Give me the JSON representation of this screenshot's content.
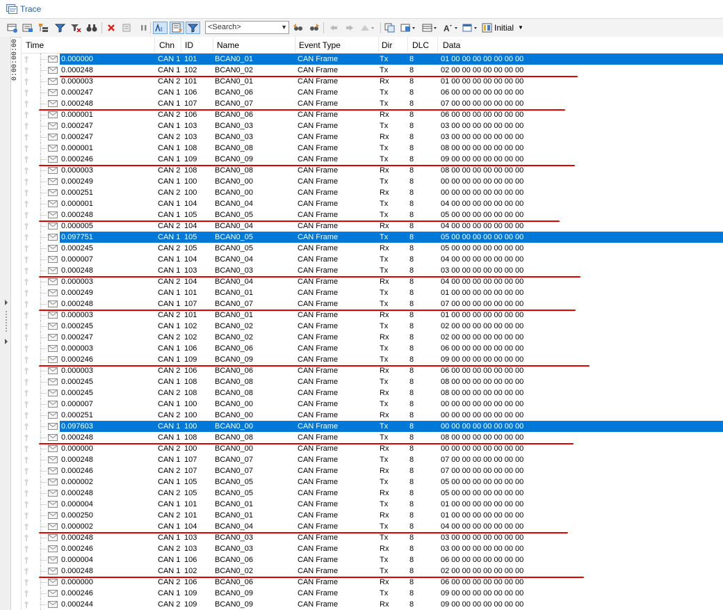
{
  "window": {
    "title": "Trace",
    "title_icon": "trace-window-icon"
  },
  "toolbar": {
    "search_placeholder": "<Search>",
    "display_mode_label": "Initial"
  },
  "timeline": {
    "label": "0:00:00:00"
  },
  "columns": [
    "Time",
    "Chn",
    "ID",
    "Name",
    "Event Type",
    "Dir",
    "DLC",
    "Data"
  ],
  "colors": {
    "selection": "#0078d7",
    "annotation_line": "#e10000",
    "title_text": "#1a5fa8"
  },
  "rows": [
    {
      "time": "0.000000",
      "chn": "CAN 1",
      "id": "101",
      "name": "BCAN0_01",
      "event": "CAN Frame",
      "dir": "Tx",
      "dlc": "8",
      "data": "01 00 00 00 00 00 00 00",
      "selected": true
    },
    {
      "time": "0.000248",
      "chn": "CAN 1",
      "id": "102",
      "name": "BCAN0_02",
      "event": "CAN Frame",
      "dir": "Tx",
      "dlc": "8",
      "data": "02 00 00 00 00 00 00 00"
    },
    {
      "time": "0.000003",
      "chn": "CAN 2",
      "id": "101",
      "name": "BCAN0_01",
      "event": "CAN Frame",
      "dir": "Rx",
      "dlc": "8",
      "data": "01 00 00 00 00 00 00 00"
    },
    {
      "time": "0.000247",
      "chn": "CAN 1",
      "id": "106",
      "name": "BCAN0_06",
      "event": "CAN Frame",
      "dir": "Tx",
      "dlc": "8",
      "data": "06 00 00 00 00 00 00 00"
    },
    {
      "time": "0.000248",
      "chn": "CAN 1",
      "id": "107",
      "name": "BCAN0_07",
      "event": "CAN Frame",
      "dir": "Tx",
      "dlc": "8",
      "data": "07 00 00 00 00 00 00 00"
    },
    {
      "time": "0.000001",
      "chn": "CAN 2",
      "id": "106",
      "name": "BCAN0_06",
      "event": "CAN Frame",
      "dir": "Rx",
      "dlc": "8",
      "data": "06 00 00 00 00 00 00 00"
    },
    {
      "time": "0.000247",
      "chn": "CAN 1",
      "id": "103",
      "name": "BCAN0_03",
      "event": "CAN Frame",
      "dir": "Tx",
      "dlc": "8",
      "data": "03 00 00 00 00 00 00 00"
    },
    {
      "time": "0.000247",
      "chn": "CAN 2",
      "id": "103",
      "name": "BCAN0_03",
      "event": "CAN Frame",
      "dir": "Rx",
      "dlc": "8",
      "data": "03 00 00 00 00 00 00 00"
    },
    {
      "time": "0.000001",
      "chn": "CAN 1",
      "id": "108",
      "name": "BCAN0_08",
      "event": "CAN Frame",
      "dir": "Tx",
      "dlc": "8",
      "data": "08 00 00 00 00 00 00 00"
    },
    {
      "time": "0.000246",
      "chn": "CAN 1",
      "id": "109",
      "name": "BCAN0_09",
      "event": "CAN Frame",
      "dir": "Tx",
      "dlc": "8",
      "data": "09 00 00 00 00 00 00 00"
    },
    {
      "time": "0.000003",
      "chn": "CAN 2",
      "id": "108",
      "name": "BCAN0_08",
      "event": "CAN Frame",
      "dir": "Rx",
      "dlc": "8",
      "data": "08 00 00 00 00 00 00 00"
    },
    {
      "time": "0.000249",
      "chn": "CAN 1",
      "id": "100",
      "name": "BCAN0_00",
      "event": "CAN Frame",
      "dir": "Tx",
      "dlc": "8",
      "data": "00 00 00 00 00 00 00 00"
    },
    {
      "time": "0.000251",
      "chn": "CAN 2",
      "id": "100",
      "name": "BCAN0_00",
      "event": "CAN Frame",
      "dir": "Rx",
      "dlc": "8",
      "data": "00 00 00 00 00 00 00 00"
    },
    {
      "time": "0.000001",
      "chn": "CAN 1",
      "id": "104",
      "name": "BCAN0_04",
      "event": "CAN Frame",
      "dir": "Tx",
      "dlc": "8",
      "data": "04 00 00 00 00 00 00 00"
    },
    {
      "time": "0.000248",
      "chn": "CAN 1",
      "id": "105",
      "name": "BCAN0_05",
      "event": "CAN Frame",
      "dir": "Tx",
      "dlc": "8",
      "data": "05 00 00 00 00 00 00 00"
    },
    {
      "time": "0.000005",
      "chn": "CAN 2",
      "id": "104",
      "name": "BCAN0_04",
      "event": "CAN Frame",
      "dir": "Rx",
      "dlc": "8",
      "data": "04 00 00 00 00 00 00 00"
    },
    {
      "time": "0.097751",
      "chn": "CAN 1",
      "id": "105",
      "name": "BCAN0_05",
      "event": "CAN Frame",
      "dir": "Tx",
      "dlc": "8",
      "data": "05 00 00 00 00 00 00 00",
      "selected": true
    },
    {
      "time": "0.000245",
      "chn": "CAN 2",
      "id": "105",
      "name": "BCAN0_05",
      "event": "CAN Frame",
      "dir": "Rx",
      "dlc": "8",
      "data": "05 00 00 00 00 00 00 00"
    },
    {
      "time": "0.000007",
      "chn": "CAN 1",
      "id": "104",
      "name": "BCAN0_04",
      "event": "CAN Frame",
      "dir": "Tx",
      "dlc": "8",
      "data": "04 00 00 00 00 00 00 00"
    },
    {
      "time": "0.000248",
      "chn": "CAN 1",
      "id": "103",
      "name": "BCAN0_03",
      "event": "CAN Frame",
      "dir": "Tx",
      "dlc": "8",
      "data": "03 00 00 00 00 00 00 00"
    },
    {
      "time": "0.000003",
      "chn": "CAN 2",
      "id": "104",
      "name": "BCAN0_04",
      "event": "CAN Frame",
      "dir": "Rx",
      "dlc": "8",
      "data": "04 00 00 00 00 00 00 00"
    },
    {
      "time": "0.000249",
      "chn": "CAN 1",
      "id": "101",
      "name": "BCAN0_01",
      "event": "CAN Frame",
      "dir": "Tx",
      "dlc": "8",
      "data": "01 00 00 00 00 00 00 00"
    },
    {
      "time": "0.000248",
      "chn": "CAN 1",
      "id": "107",
      "name": "BCAN0_07",
      "event": "CAN Frame",
      "dir": "Tx",
      "dlc": "8",
      "data": "07 00 00 00 00 00 00 00"
    },
    {
      "time": "0.000003",
      "chn": "CAN 2",
      "id": "101",
      "name": "BCAN0_01",
      "event": "CAN Frame",
      "dir": "Rx",
      "dlc": "8",
      "data": "01 00 00 00 00 00 00 00"
    },
    {
      "time": "0.000245",
      "chn": "CAN 1",
      "id": "102",
      "name": "BCAN0_02",
      "event": "CAN Frame",
      "dir": "Tx",
      "dlc": "8",
      "data": "02 00 00 00 00 00 00 00"
    },
    {
      "time": "0.000247",
      "chn": "CAN 2",
      "id": "102",
      "name": "BCAN0_02",
      "event": "CAN Frame",
      "dir": "Rx",
      "dlc": "8",
      "data": "02 00 00 00 00 00 00 00"
    },
    {
      "time": "0.000003",
      "chn": "CAN 1",
      "id": "106",
      "name": "BCAN0_06",
      "event": "CAN Frame",
      "dir": "Tx",
      "dlc": "8",
      "data": "06 00 00 00 00 00 00 00"
    },
    {
      "time": "0.000246",
      "chn": "CAN 1",
      "id": "109",
      "name": "BCAN0_09",
      "event": "CAN Frame",
      "dir": "Tx",
      "dlc": "8",
      "data": "09 00 00 00 00 00 00 00"
    },
    {
      "time": "0.000003",
      "chn": "CAN 2",
      "id": "106",
      "name": "BCAN0_06",
      "event": "CAN Frame",
      "dir": "Rx",
      "dlc": "8",
      "data": "06 00 00 00 00 00 00 00"
    },
    {
      "time": "0.000245",
      "chn": "CAN 1",
      "id": "108",
      "name": "BCAN0_08",
      "event": "CAN Frame",
      "dir": "Tx",
      "dlc": "8",
      "data": "08 00 00 00 00 00 00 00"
    },
    {
      "time": "0.000245",
      "chn": "CAN 2",
      "id": "108",
      "name": "BCAN0_08",
      "event": "CAN Frame",
      "dir": "Rx",
      "dlc": "8",
      "data": "08 00 00 00 00 00 00 00"
    },
    {
      "time": "0.000007",
      "chn": "CAN 1",
      "id": "100",
      "name": "BCAN0_00",
      "event": "CAN Frame",
      "dir": "Tx",
      "dlc": "8",
      "data": "00 00 00 00 00 00 00 00"
    },
    {
      "time": "0.000251",
      "chn": "CAN 2",
      "id": "100",
      "name": "BCAN0_00",
      "event": "CAN Frame",
      "dir": "Rx",
      "dlc": "8",
      "data": "00 00 00 00 00 00 00 00"
    },
    {
      "time": "0.097603",
      "chn": "CAN 1",
      "id": "100",
      "name": "BCAN0_00",
      "event": "CAN Frame",
      "dir": "Tx",
      "dlc": "8",
      "data": "00 00 00 00 00 00 00 00",
      "selected": true
    },
    {
      "time": "0.000248",
      "chn": "CAN 1",
      "id": "108",
      "name": "BCAN0_08",
      "event": "CAN Frame",
      "dir": "Tx",
      "dlc": "8",
      "data": "08 00 00 00 00 00 00 00"
    },
    {
      "time": "0.000000",
      "chn": "CAN 2",
      "id": "100",
      "name": "BCAN0_00",
      "event": "CAN Frame",
      "dir": "Rx",
      "dlc": "8",
      "data": "00 00 00 00 00 00 00 00"
    },
    {
      "time": "0.000248",
      "chn": "CAN 1",
      "id": "107",
      "name": "BCAN0_07",
      "event": "CAN Frame",
      "dir": "Tx",
      "dlc": "8",
      "data": "07 00 00 00 00 00 00 00"
    },
    {
      "time": "0.000246",
      "chn": "CAN 2",
      "id": "107",
      "name": "BCAN0_07",
      "event": "CAN Frame",
      "dir": "Rx",
      "dlc": "8",
      "data": "07 00 00 00 00 00 00 00"
    },
    {
      "time": "0.000002",
      "chn": "CAN 1",
      "id": "105",
      "name": "BCAN0_05",
      "event": "CAN Frame",
      "dir": "Tx",
      "dlc": "8",
      "data": "05 00 00 00 00 00 00 00"
    },
    {
      "time": "0.000248",
      "chn": "CAN 2",
      "id": "105",
      "name": "BCAN0_05",
      "event": "CAN Frame",
      "dir": "Rx",
      "dlc": "8",
      "data": "05 00 00 00 00 00 00 00"
    },
    {
      "time": "0.000004",
      "chn": "CAN 1",
      "id": "101",
      "name": "BCAN0_01",
      "event": "CAN Frame",
      "dir": "Tx",
      "dlc": "8",
      "data": "01 00 00 00 00 00 00 00"
    },
    {
      "time": "0.000250",
      "chn": "CAN 2",
      "id": "101",
      "name": "BCAN0_01",
      "event": "CAN Frame",
      "dir": "Rx",
      "dlc": "8",
      "data": "01 00 00 00 00 00 00 00"
    },
    {
      "time": "0.000002",
      "chn": "CAN 1",
      "id": "104",
      "name": "BCAN0_04",
      "event": "CAN Frame",
      "dir": "Tx",
      "dlc": "8",
      "data": "04 00 00 00 00 00 00 00"
    },
    {
      "time": "0.000248",
      "chn": "CAN 1",
      "id": "103",
      "name": "BCAN0_03",
      "event": "CAN Frame",
      "dir": "Tx",
      "dlc": "8",
      "data": "03 00 00 00 00 00 00 00"
    },
    {
      "time": "0.000246",
      "chn": "CAN 2",
      "id": "103",
      "name": "BCAN0_03",
      "event": "CAN Frame",
      "dir": "Rx",
      "dlc": "8",
      "data": "03 00 00 00 00 00 00 00"
    },
    {
      "time": "0.000004",
      "chn": "CAN 1",
      "id": "106",
      "name": "BCAN0_06",
      "event": "CAN Frame",
      "dir": "Tx",
      "dlc": "8",
      "data": "06 00 00 00 00 00 00 00"
    },
    {
      "time": "0.000248",
      "chn": "CAN 1",
      "id": "102",
      "name": "BCAN0_02",
      "event": "CAN Frame",
      "dir": "Tx",
      "dlc": "8",
      "data": "02 00 00 00 00 00 00 00"
    },
    {
      "time": "0.000000",
      "chn": "CAN 2",
      "id": "106",
      "name": "BCAN0_06",
      "event": "CAN Frame",
      "dir": "Rx",
      "dlc": "8",
      "data": "06 00 00 00 00 00 00 00"
    },
    {
      "time": "0.000246",
      "chn": "CAN 1",
      "id": "109",
      "name": "BCAN0_09",
      "event": "CAN Frame",
      "dir": "Tx",
      "dlc": "8",
      "data": "09 00 00 00 00 00 00 00"
    },
    {
      "time": "0.000244",
      "chn": "CAN 2",
      "id": "109",
      "name": "BCAN0_09",
      "event": "CAN Frame",
      "dir": "Rx",
      "dlc": "8",
      "data": "09 00 00 00 00 00 00 00"
    }
  ],
  "annotations": {
    "description": "",
    "underlined_row_indices": [
      1,
      4,
      9,
      14,
      19,
      22,
      27,
      34,
      42,
      46
    ]
  }
}
